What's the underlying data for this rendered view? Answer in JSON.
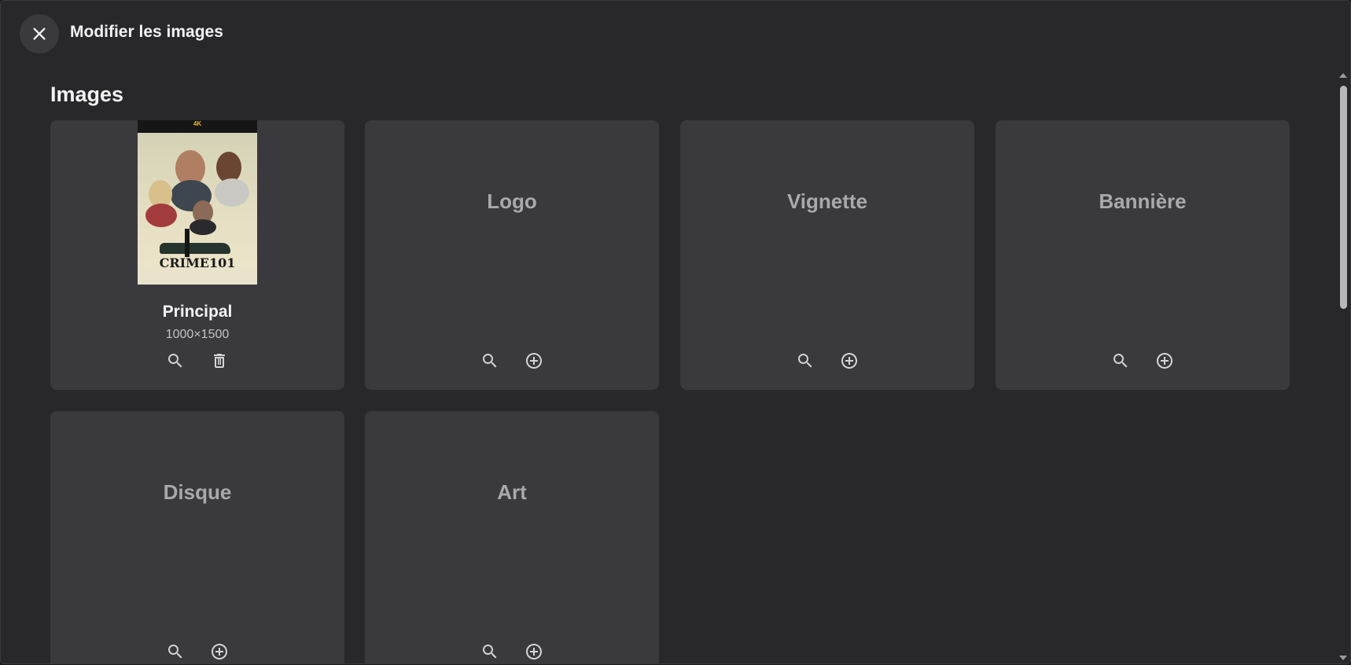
{
  "header": {
    "title": "Modifier les images",
    "close_icon": "close-icon"
  },
  "section": {
    "title": "Images"
  },
  "cards": [
    {
      "label": "Principal",
      "size": "1000×1500",
      "has_image": true,
      "poster_text": "CRIME101",
      "poster_badge": "4K",
      "actions": [
        "search-icon",
        "trash-icon"
      ]
    },
    {
      "label": "Logo",
      "has_image": false,
      "actions": [
        "search-icon",
        "add-circle-icon"
      ]
    },
    {
      "label": "Vignette",
      "has_image": false,
      "actions": [
        "search-icon",
        "add-circle-icon"
      ]
    },
    {
      "label": "Bannière",
      "has_image": false,
      "actions": [
        "search-icon",
        "add-circle-icon"
      ]
    },
    {
      "label": "Disque",
      "has_image": false,
      "actions": [
        "search-icon",
        "add-circle-icon"
      ]
    },
    {
      "label": "Art",
      "has_image": false,
      "actions": [
        "search-icon",
        "add-circle-icon"
      ]
    }
  ],
  "colors": {
    "background": "#28282a",
    "card": "#3a393e",
    "placeholder_text": "#a9a9ad"
  }
}
